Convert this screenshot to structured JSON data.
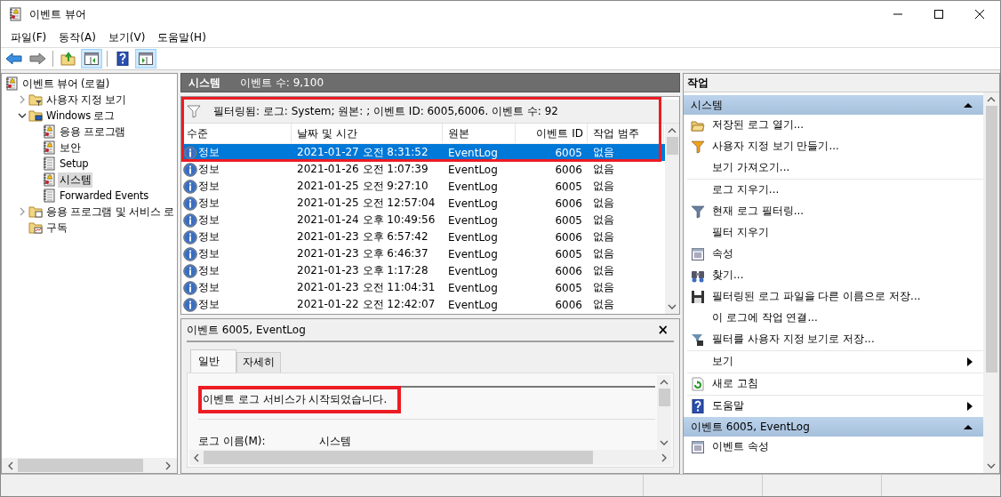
{
  "window": {
    "title": "이벤트 뷰어"
  },
  "menu": [
    "파일(F)",
    "동작(A)",
    "보기(V)",
    "도움말(H)"
  ],
  "toolbar": [
    {
      "kind": "back",
      "pressed": false
    },
    {
      "kind": "forward",
      "pressed": false
    },
    {
      "kind": "separator"
    },
    {
      "kind": "up",
      "pressed": false
    },
    {
      "kind": "tree-pane",
      "pressed": true
    },
    {
      "kind": "separator"
    },
    {
      "kind": "help",
      "pressed": false
    },
    {
      "kind": "action-pane",
      "pressed": true
    }
  ],
  "tree": [
    {
      "label": "이벤트 뷰어 (로컬)",
      "kind": "log",
      "selected": false,
      "children": [
        {
          "label": "사용자 지정 보기",
          "kind": "folder-filter",
          "selected": false,
          "expanded": false
        },
        {
          "label": "Windows 로그",
          "kind": "folder-pc",
          "selected": false,
          "expanded": true,
          "children": [
            {
              "label": "응용 프로그램",
              "kind": "log",
              "selected": false
            },
            {
              "label": "보안",
              "kind": "log",
              "selected": false
            },
            {
              "label": "Setup",
              "kind": "log-plain",
              "selected": false
            },
            {
              "label": "시스템",
              "kind": "log",
              "selected": true
            },
            {
              "label": "Forwarded Events",
              "kind": "log-plain",
              "selected": false
            }
          ]
        },
        {
          "label": "응용 프로그램 및 서비스 로",
          "kind": "folder-doc",
          "selected": false,
          "expanded": false
        },
        {
          "label": "구독",
          "kind": "folder-sub",
          "selected": false
        }
      ]
    }
  ],
  "log_view": {
    "title": "시스템",
    "event_count": "이벤트 수: 9,100",
    "highlight": true,
    "filter": "필터링됨: 로그: System; 원본: ; 이벤트 ID: 6005,6006. 이벤트 수: 92",
    "columns": [
      "수준",
      "날짜 및 시간",
      "원본",
      "이벤트 ID",
      "작업 범주"
    ],
    "rows": [
      {
        "severity": "정보",
        "date": "2021-01-27 오전 8:31:52",
        "source": "EventLog",
        "event_id": "6005",
        "category": "없음",
        "selected": true
      },
      {
        "severity": "정보",
        "date": "2021-01-26 오전 1:07:39",
        "source": "EventLog",
        "event_id": "6006",
        "category": "없음",
        "selected": false
      },
      {
        "severity": "정보",
        "date": "2021-01-25 오전 9:27:10",
        "source": "EventLog",
        "event_id": "6005",
        "category": "없음",
        "selected": false
      },
      {
        "severity": "정보",
        "date": "2021-01-25 오전 12:57:04",
        "source": "EventLog",
        "event_id": "6006",
        "category": "없음",
        "selected": false
      },
      {
        "severity": "정보",
        "date": "2021-01-24 오후 10:49:56",
        "source": "EventLog",
        "event_id": "6005",
        "category": "없음",
        "selected": false
      },
      {
        "severity": "정보",
        "date": "2021-01-23 오후 6:57:42",
        "source": "EventLog",
        "event_id": "6006",
        "category": "없음",
        "selected": false
      },
      {
        "severity": "정보",
        "date": "2021-01-23 오후 6:46:37",
        "source": "EventLog",
        "event_id": "6005",
        "category": "없음",
        "selected": false
      },
      {
        "severity": "정보",
        "date": "2021-01-23 오후 1:17:28",
        "source": "EventLog",
        "event_id": "6006",
        "category": "없음",
        "selected": false
      },
      {
        "severity": "정보",
        "date": "2021-01-23 오전 11:04:31",
        "source": "EventLog",
        "event_id": "6005",
        "category": "없음",
        "selected": false
      },
      {
        "severity": "정보",
        "date": "2021-01-22 오전 12:42:07",
        "source": "EventLog",
        "event_id": "6006",
        "category": "없음",
        "selected": false
      }
    ]
  },
  "detail": {
    "title": "이벤트 6005, EventLog",
    "close": "×",
    "tabs": [
      {
        "label": "일반",
        "selected": true
      },
      {
        "label": "자세히",
        "selected": false
      }
    ],
    "description": "이벤트 로그 서비스가 시작되었습니다.",
    "highlight": true,
    "fields": [
      {
        "label": "로그 이름(M):",
        "value": "시스템"
      }
    ]
  },
  "actions": {
    "title": "작업",
    "sections": [
      {
        "title": "시스템",
        "expanded": true,
        "items": [
          {
            "label": "저장된 로그 열기...",
            "kind": "open-folder",
            "separator_before": false,
            "submenu": false
          },
          {
            "label": "사용자 지정 보기 만들기...",
            "kind": "funnel-star",
            "separator_before": false,
            "submenu": false
          },
          {
            "label": "보기 가져오기...",
            "separator_before": false,
            "submenu": false
          },
          {
            "label": "로그 지우기...",
            "separator_before": true,
            "submenu": false
          },
          {
            "label": "현재 로그 필터링...",
            "kind": "funnel",
            "separator_before": false,
            "submenu": false
          },
          {
            "label": "필터 지우기",
            "separator_before": false,
            "submenu": false
          },
          {
            "label": "속성",
            "kind": "properties",
            "separator_before": false,
            "submenu": false
          },
          {
            "label": "찾기...",
            "kind": "binoculars",
            "separator_before": false,
            "submenu": false
          },
          {
            "label": "필터링된 로그 파일을 다른 이름으로 저장...",
            "kind": "floppy",
            "separator_before": false,
            "submenu": false
          },
          {
            "label": "이 로그에 작업 연결...",
            "separator_before": false,
            "submenu": false
          },
          {
            "label": "필터를 사용자 지정 보기로 저장...",
            "kind": "funnel-save",
            "separator_before": false,
            "submenu": false
          },
          {
            "label": "보기",
            "separator_before": true,
            "submenu": true
          },
          {
            "label": "새로 고침",
            "kind": "refresh",
            "separator_before": true,
            "submenu": false
          },
          {
            "label": "도움말",
            "kind": "help",
            "separator_before": true,
            "submenu": true
          }
        ]
      },
      {
        "title": "이벤트 6005, EventLog",
        "expanded": true,
        "items": [
          {
            "label": "이벤트 속성",
            "kind": "properties",
            "separator_before": false,
            "submenu": false
          }
        ]
      }
    ]
  }
}
